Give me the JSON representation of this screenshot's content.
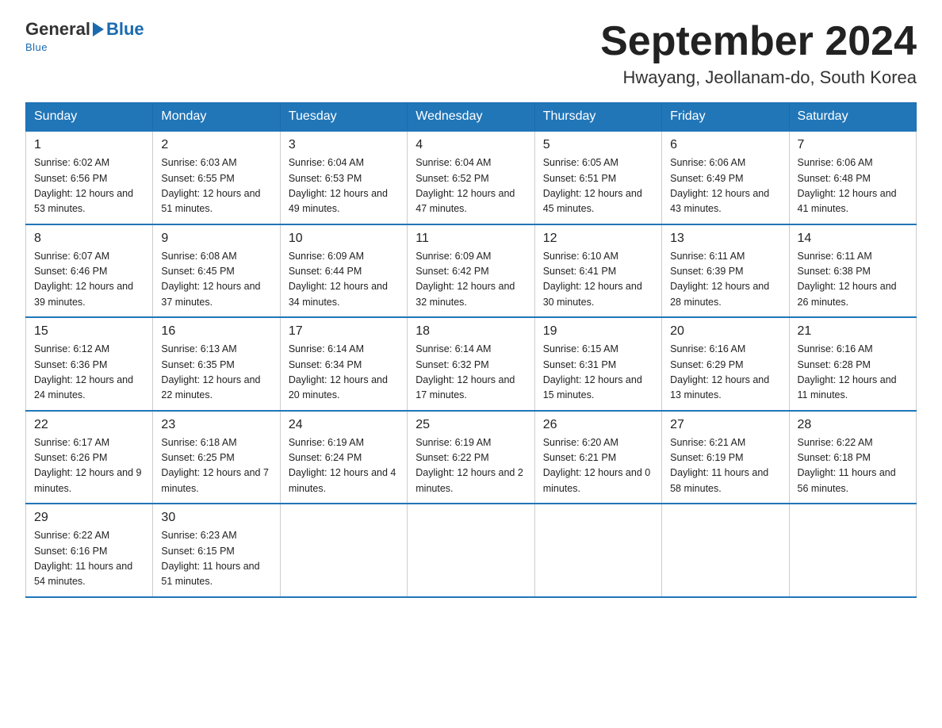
{
  "header": {
    "logo_general": "General",
    "logo_blue": "Blue",
    "title": "September 2024",
    "subtitle": "Hwayang, Jeollanam-do, South Korea"
  },
  "weekdays": [
    "Sunday",
    "Monday",
    "Tuesday",
    "Wednesday",
    "Thursday",
    "Friday",
    "Saturday"
  ],
  "weeks": [
    [
      {
        "day": "1",
        "sunrise": "6:02 AM",
        "sunset": "6:56 PM",
        "daylight": "12 hours and 53 minutes."
      },
      {
        "day": "2",
        "sunrise": "6:03 AM",
        "sunset": "6:55 PM",
        "daylight": "12 hours and 51 minutes."
      },
      {
        "day": "3",
        "sunrise": "6:04 AM",
        "sunset": "6:53 PM",
        "daylight": "12 hours and 49 minutes."
      },
      {
        "day": "4",
        "sunrise": "6:04 AM",
        "sunset": "6:52 PM",
        "daylight": "12 hours and 47 minutes."
      },
      {
        "day": "5",
        "sunrise": "6:05 AM",
        "sunset": "6:51 PM",
        "daylight": "12 hours and 45 minutes."
      },
      {
        "day": "6",
        "sunrise": "6:06 AM",
        "sunset": "6:49 PM",
        "daylight": "12 hours and 43 minutes."
      },
      {
        "day": "7",
        "sunrise": "6:06 AM",
        "sunset": "6:48 PM",
        "daylight": "12 hours and 41 minutes."
      }
    ],
    [
      {
        "day": "8",
        "sunrise": "6:07 AM",
        "sunset": "6:46 PM",
        "daylight": "12 hours and 39 minutes."
      },
      {
        "day": "9",
        "sunrise": "6:08 AM",
        "sunset": "6:45 PM",
        "daylight": "12 hours and 37 minutes."
      },
      {
        "day": "10",
        "sunrise": "6:09 AM",
        "sunset": "6:44 PM",
        "daylight": "12 hours and 34 minutes."
      },
      {
        "day": "11",
        "sunrise": "6:09 AM",
        "sunset": "6:42 PM",
        "daylight": "12 hours and 32 minutes."
      },
      {
        "day": "12",
        "sunrise": "6:10 AM",
        "sunset": "6:41 PM",
        "daylight": "12 hours and 30 minutes."
      },
      {
        "day": "13",
        "sunrise": "6:11 AM",
        "sunset": "6:39 PM",
        "daylight": "12 hours and 28 minutes."
      },
      {
        "day": "14",
        "sunrise": "6:11 AM",
        "sunset": "6:38 PM",
        "daylight": "12 hours and 26 minutes."
      }
    ],
    [
      {
        "day": "15",
        "sunrise": "6:12 AM",
        "sunset": "6:36 PM",
        "daylight": "12 hours and 24 minutes."
      },
      {
        "day": "16",
        "sunrise": "6:13 AM",
        "sunset": "6:35 PM",
        "daylight": "12 hours and 22 minutes."
      },
      {
        "day": "17",
        "sunrise": "6:14 AM",
        "sunset": "6:34 PM",
        "daylight": "12 hours and 20 minutes."
      },
      {
        "day": "18",
        "sunrise": "6:14 AM",
        "sunset": "6:32 PM",
        "daylight": "12 hours and 17 minutes."
      },
      {
        "day": "19",
        "sunrise": "6:15 AM",
        "sunset": "6:31 PM",
        "daylight": "12 hours and 15 minutes."
      },
      {
        "day": "20",
        "sunrise": "6:16 AM",
        "sunset": "6:29 PM",
        "daylight": "12 hours and 13 minutes."
      },
      {
        "day": "21",
        "sunrise": "6:16 AM",
        "sunset": "6:28 PM",
        "daylight": "12 hours and 11 minutes."
      }
    ],
    [
      {
        "day": "22",
        "sunrise": "6:17 AM",
        "sunset": "6:26 PM",
        "daylight": "12 hours and 9 minutes."
      },
      {
        "day": "23",
        "sunrise": "6:18 AM",
        "sunset": "6:25 PM",
        "daylight": "12 hours and 7 minutes."
      },
      {
        "day": "24",
        "sunrise": "6:19 AM",
        "sunset": "6:24 PM",
        "daylight": "12 hours and 4 minutes."
      },
      {
        "day": "25",
        "sunrise": "6:19 AM",
        "sunset": "6:22 PM",
        "daylight": "12 hours and 2 minutes."
      },
      {
        "day": "26",
        "sunrise": "6:20 AM",
        "sunset": "6:21 PM",
        "daylight": "12 hours and 0 minutes."
      },
      {
        "day": "27",
        "sunrise": "6:21 AM",
        "sunset": "6:19 PM",
        "daylight": "11 hours and 58 minutes."
      },
      {
        "day": "28",
        "sunrise": "6:22 AM",
        "sunset": "6:18 PM",
        "daylight": "11 hours and 56 minutes."
      }
    ],
    [
      {
        "day": "29",
        "sunrise": "6:22 AM",
        "sunset": "6:16 PM",
        "daylight": "11 hours and 54 minutes."
      },
      {
        "day": "30",
        "sunrise": "6:23 AM",
        "sunset": "6:15 PM",
        "daylight": "11 hours and 51 minutes."
      },
      null,
      null,
      null,
      null,
      null
    ]
  ]
}
